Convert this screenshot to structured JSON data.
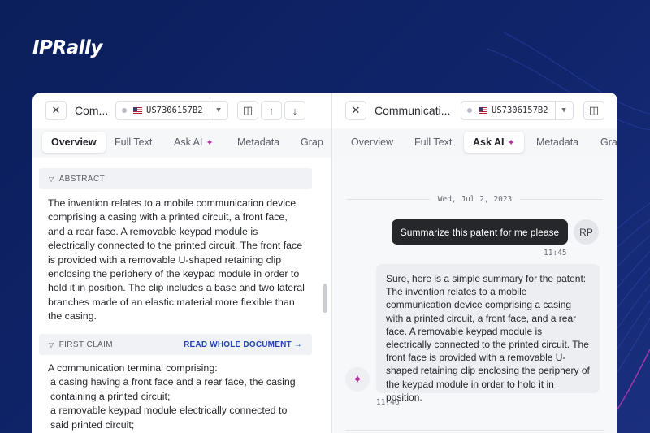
{
  "brand": {
    "logo": "IPRally"
  },
  "left_pane": {
    "close_icon": "close-icon",
    "title": "Com...",
    "patent_number": "US7306157B2",
    "tabs": [
      {
        "label": "Overview",
        "active": true
      },
      {
        "label": "Full Text"
      },
      {
        "label": "Ask AI"
      },
      {
        "label": "Metadata"
      },
      {
        "label": "Grap"
      }
    ],
    "abstract": {
      "heading": "ABSTRACT",
      "text": "The invention relates to a mobile communication device comprising a casing with a printed circuit, a front face, and a rear face. A removable keypad module is electrically connected to the printed circuit. The front face is provided with a removable U-shaped retaining clip enclosing the periphery of the keypad module in order to hold it in position. The clip includes a base and two lateral branches made of an elastic material more flexible than the casing."
    },
    "first_claim": {
      "heading": "FIRST CLAIM",
      "link_label": "READ WHOLE DOCUMENT",
      "lines": [
        "A communication terminal comprising:",
        "a casing having a front face and a rear face, the casing containing a printed circuit;",
        "a removable keypad module electrically connected to said printed circuit;"
      ]
    }
  },
  "right_pane": {
    "title": "Communicati...",
    "patent_number": "US7306157B2",
    "tabs": [
      {
        "label": "Overview"
      },
      {
        "label": "Full Text"
      },
      {
        "label": "Ask AI",
        "active": true
      },
      {
        "label": "Metadata"
      },
      {
        "label": "Grap"
      }
    ],
    "chat": {
      "date": "Wed, Jul 2, 2023",
      "user_message": "Summarize this patent for me please",
      "user_initials": "RP",
      "user_time": "11:45",
      "ai_message": "Sure, here is a simple summary for the patent: The invention relates to a mobile communication device comprising a casing with a printed circuit, a front face, and a rear face. A removable keypad module is electrically connected to the printed circuit. The front face is provided with a removable U-shaped retaining clip enclosing the periphery of the keypad module in order to hold it in position.",
      "ai_time": "11:46"
    }
  },
  "colors": {
    "background": "#0b1f5c",
    "accent": "#2442b5",
    "ai_spark": "#b0309a",
    "user_bubble": "#26272b"
  }
}
